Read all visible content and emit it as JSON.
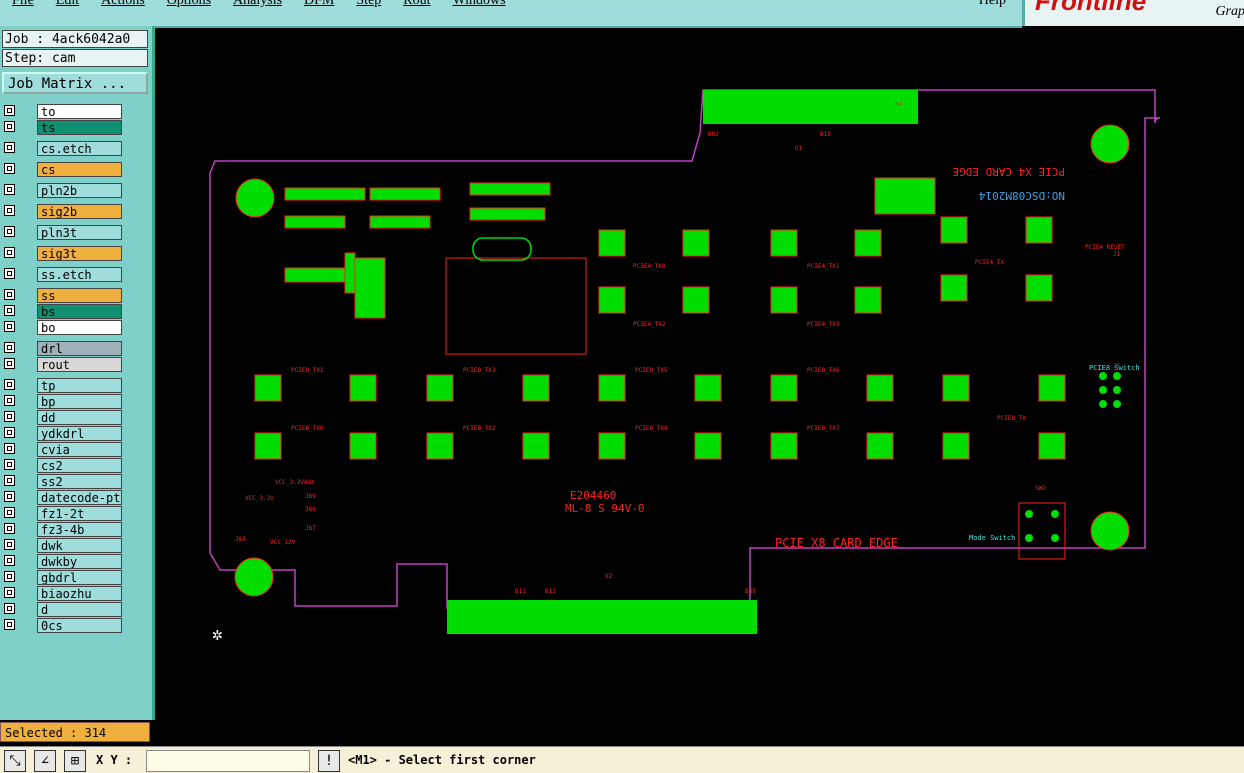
{
  "menu": [
    "File",
    "Edit",
    "Actions",
    "Options",
    "Analysis",
    "DFM",
    "Step",
    "Rout",
    "Windows"
  ],
  "help": "Help",
  "brand": "Frontline",
  "brand_sub": "Grap",
  "job_label": "Job : 4ack6042a0",
  "step_label": "Step: cam",
  "job_matrix": "Job Matrix ...",
  "layers": [
    {
      "name": "to",
      "color": "#ffffff"
    },
    {
      "name": "ts",
      "color": "#109070"
    },
    {
      "name": "cs.etch",
      "color": "#9fdcdc"
    },
    {
      "name": "cs",
      "color": "#f0b040"
    },
    {
      "name": "pln2b",
      "color": "#9fdcdc"
    },
    {
      "name": "sig2b",
      "color": "#f0b040"
    },
    {
      "name": "pln3t",
      "color": "#9fdcdc"
    },
    {
      "name": "sig3t",
      "color": "#f0b040"
    },
    {
      "name": "ss.etch",
      "color": "#9fdcdc"
    },
    {
      "name": "ss",
      "color": "#f0b040"
    },
    {
      "name": "bs",
      "color": "#109070"
    },
    {
      "name": "bo",
      "color": "#ffffff"
    },
    {
      "name": "drl",
      "color": "#a0b0b8"
    },
    {
      "name": "rout",
      "color": "#d8d8d8"
    },
    {
      "name": "tp",
      "color": "#9fdcdc"
    },
    {
      "name": "bp",
      "color": "#9fdcdc"
    },
    {
      "name": "dd",
      "color": "#9fdcdc"
    },
    {
      "name": "ydkdrl",
      "color": "#9fdcdc"
    },
    {
      "name": "cvia",
      "color": "#9fdcdc"
    },
    {
      "name": "cs2",
      "color": "#9fdcdc"
    },
    {
      "name": "ss2",
      "color": "#9fdcdc"
    },
    {
      "name": "datecode-pte",
      "color": "#9fdcdc"
    },
    {
      "name": "fz1-2t",
      "color": "#9fdcdc"
    },
    {
      "name": "fz3-4b",
      "color": "#9fdcdc"
    },
    {
      "name": "dwk",
      "color": "#9fdcdc"
    },
    {
      "name": "dwkby",
      "color": "#9fdcdc"
    },
    {
      "name": "gbdrl",
      "color": "#9fdcdc"
    },
    {
      "name": "biaozhu",
      "color": "#9fdcdc"
    },
    {
      "name": "d",
      "color": "#9fdcdc"
    },
    {
      "name": "0cs",
      "color": "#9fdcdc"
    }
  ],
  "selected": "Selected : 314",
  "xy_label": "X Y :",
  "prompt": "<M1> - Select first corner",
  "board": {
    "title_x4": "PCIE X4 CARD EDGE",
    "title_x8": "PCIE X8 CARD EDGE",
    "part_no": "NO:DSC08M2014",
    "ul_no": "E204460",
    "ul_text": "ML-8 S 94V-0",
    "mode_switch": "Mode Switch",
    "pcie_switch": "PCIE8 Switch",
    "pcie_reset": "PCIE4 RESET",
    "pad_labels": [
      "PCIE8_TX1",
      "PCIE8_TX3",
      "PCIE8_TX5",
      "PCIE8_TX6",
      "PCIE8_TX0",
      "PCIE8_TX2",
      "PCIE8_TX4",
      "PCIE8_TX7",
      "PCIE4_TX0",
      "PCIE4_TX1",
      "PCIE4_TX2",
      "PCIE4_TX3",
      "PCIE4_TX",
      "PCIE8_TX"
    ],
    "misc_labels": [
      "VCC_3.3V",
      "VCC_3.3VAUX",
      "VCC_12V",
      "J69",
      "J66",
      "J67",
      "J60",
      "SW2",
      "J1",
      "J5",
      "U1",
      "V2",
      "B1",
      "B11",
      "B12",
      "B49",
      "B82",
      "B18"
    ]
  },
  "colors": {
    "pad": "#00dd00",
    "silk": "#ff2020",
    "outline": "#c040c0",
    "cyan_text": "#40e0e0"
  }
}
